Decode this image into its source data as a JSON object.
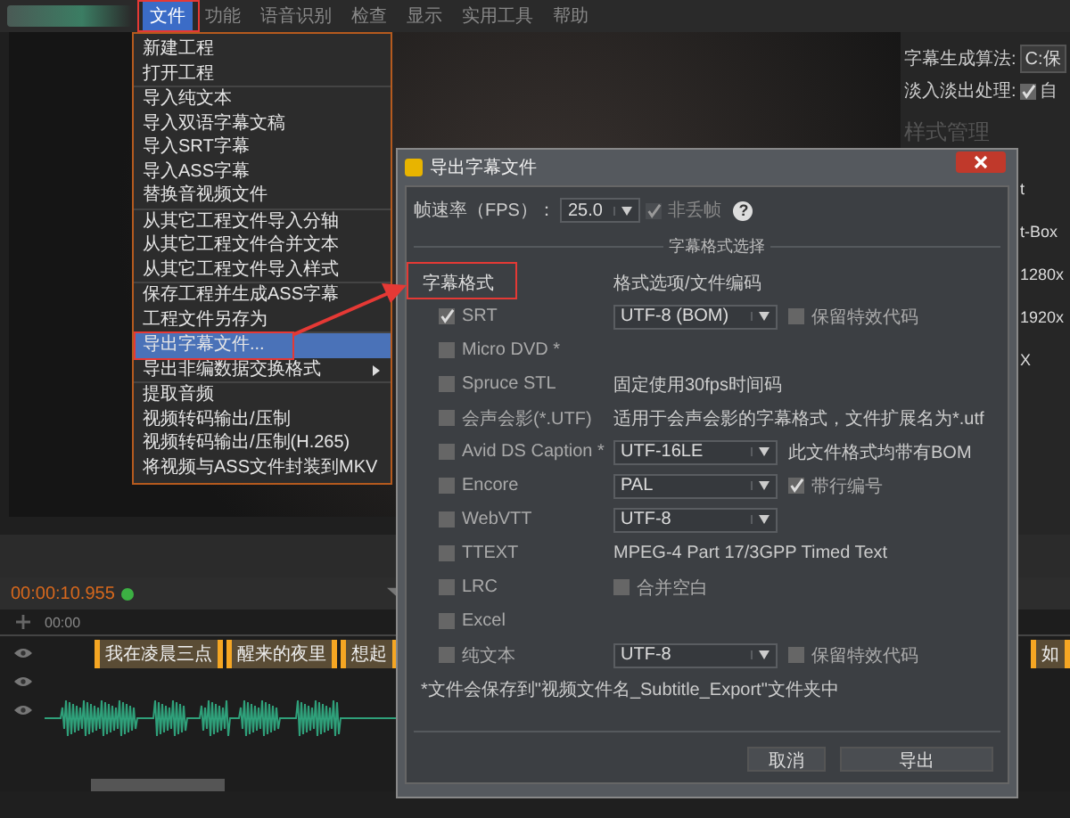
{
  "menu_bar": {
    "items": [
      {
        "label": "文件",
        "selected": true
      },
      {
        "label": "功能",
        "selected": false
      },
      {
        "label": "语音识别",
        "selected": false
      },
      {
        "label": "检查",
        "selected": false
      },
      {
        "label": "显示",
        "selected": false
      },
      {
        "label": "实用工具",
        "selected": false
      },
      {
        "label": "帮助",
        "selected": false
      }
    ]
  },
  "file_menu": {
    "groups": [
      [
        {
          "label": "新建工程",
          "selected": false,
          "has_submenu": false
        },
        {
          "label": "打开工程",
          "selected": false,
          "has_submenu": false
        }
      ],
      [
        {
          "label": "导入纯文本",
          "selected": false,
          "has_submenu": false
        },
        {
          "label": "导入双语字幕文稿",
          "selected": false,
          "has_submenu": false
        },
        {
          "label": "导入SRT字幕",
          "selected": false,
          "has_submenu": false
        },
        {
          "label": "导入ASS字幕",
          "selected": false,
          "has_submenu": false
        },
        {
          "label": "替换音视频文件",
          "selected": false,
          "has_submenu": false
        }
      ],
      [
        {
          "label": "从其它工程文件导入分轴",
          "selected": false,
          "has_submenu": false
        },
        {
          "label": "从其它工程文件合并文本",
          "selected": false,
          "has_submenu": false
        },
        {
          "label": "从其它工程文件导入样式",
          "selected": false,
          "has_submenu": false
        }
      ],
      [
        {
          "label": "保存工程并生成ASS字幕",
          "selected": false,
          "has_submenu": false
        },
        {
          "label": "工程文件另存为",
          "selected": false,
          "has_submenu": false
        }
      ],
      [
        {
          "label": "导出字幕文件...",
          "selected": true,
          "has_submenu": false
        },
        {
          "label": "导出非编数据交换格式",
          "selected": false,
          "has_submenu": true
        }
      ],
      [
        {
          "label": "提取音频",
          "selected": false,
          "has_submenu": false
        },
        {
          "label": "视频转码输出/压制",
          "selected": false,
          "has_submenu": false
        },
        {
          "label": "视频转码输出/压制(H.265)",
          "selected": false,
          "has_submenu": false
        },
        {
          "label": "将视频与ASS文件封装到MKV",
          "selected": false,
          "has_submenu": false
        }
      ]
    ]
  },
  "right_panel": {
    "algorithm_label": "字幕生成算法:",
    "algorithm_value": "C:保",
    "fade_label": "淡入淡出处理:",
    "fade": {
      "checked": true,
      "label": "自"
    },
    "style_title": "样式管理",
    "style_items": [
      "t",
      "t-Box",
      "1280x",
      "1920x",
      "X"
    ]
  },
  "timeline": {
    "time": "00:00:10.955",
    "ruler_label": "00:00",
    "subtitles": [
      "我在凌晨三点",
      "醒来的夜里",
      "想起"
    ],
    "right_subtitle": "如"
  },
  "dialog": {
    "title": "导出字幕文件",
    "fps_label": "帧速率（FPS）：",
    "fps_value": "25.0",
    "non_drop": {
      "label": "非丢帧",
      "checked": true
    },
    "help": "?",
    "group_title": "字幕格式选择",
    "headers": [
      "字幕格式",
      "格式选项/文件编码"
    ],
    "formats": [
      {
        "name": "SRT",
        "checked": true,
        "options": [
          {
            "kind": "select",
            "value": "UTF-8 (BOM)"
          },
          {
            "kind": "checkbox",
            "label": "保留特效代码",
            "checked": false
          }
        ]
      },
      {
        "name": "Micro DVD *",
        "checked": false
      },
      {
        "name": "Spruce STL",
        "checked": false,
        "options": [
          {
            "kind": "text",
            "text": "固定使用30fps时间码"
          }
        ]
      },
      {
        "name": "会声会影(*.UTF)",
        "checked": false,
        "options": [
          {
            "kind": "text",
            "text": "适用于会声会影的字幕格式，文件扩展名为*.utf"
          }
        ]
      },
      {
        "name": "Avid DS Caption *",
        "checked": false,
        "options": [
          {
            "kind": "select",
            "value": "UTF-16LE"
          },
          {
            "kind": "text",
            "text": "此文件格式均带有BOM"
          }
        ]
      },
      {
        "name": "Encore",
        "checked": false,
        "options": [
          {
            "kind": "select",
            "value": "PAL"
          },
          {
            "kind": "checkbox",
            "label": "带行编号",
            "checked": true
          }
        ]
      },
      {
        "name": "WebVTT",
        "checked": false,
        "options": [
          {
            "kind": "select",
            "value": "UTF-8"
          }
        ]
      },
      {
        "name": "TTEXT",
        "checked": false,
        "options": [
          {
            "kind": "text",
            "text": "MPEG-4 Part 17/3GPP Timed Text"
          }
        ]
      },
      {
        "name": "LRC",
        "checked": false,
        "options": [
          {
            "kind": "checkbox",
            "label": "合并空白",
            "checked": false
          }
        ]
      },
      {
        "name": "Excel",
        "checked": false
      },
      {
        "name": "纯文本",
        "checked": false,
        "options": [
          {
            "kind": "select",
            "value": "UTF-8"
          },
          {
            "kind": "checkbox",
            "label": "保留特效代码",
            "checked": false
          }
        ]
      }
    ],
    "note": "*文件会保存到\"视频文件名_Subtitle_Export\"文件夹中",
    "buttons": [
      "取消",
      "导出"
    ]
  }
}
